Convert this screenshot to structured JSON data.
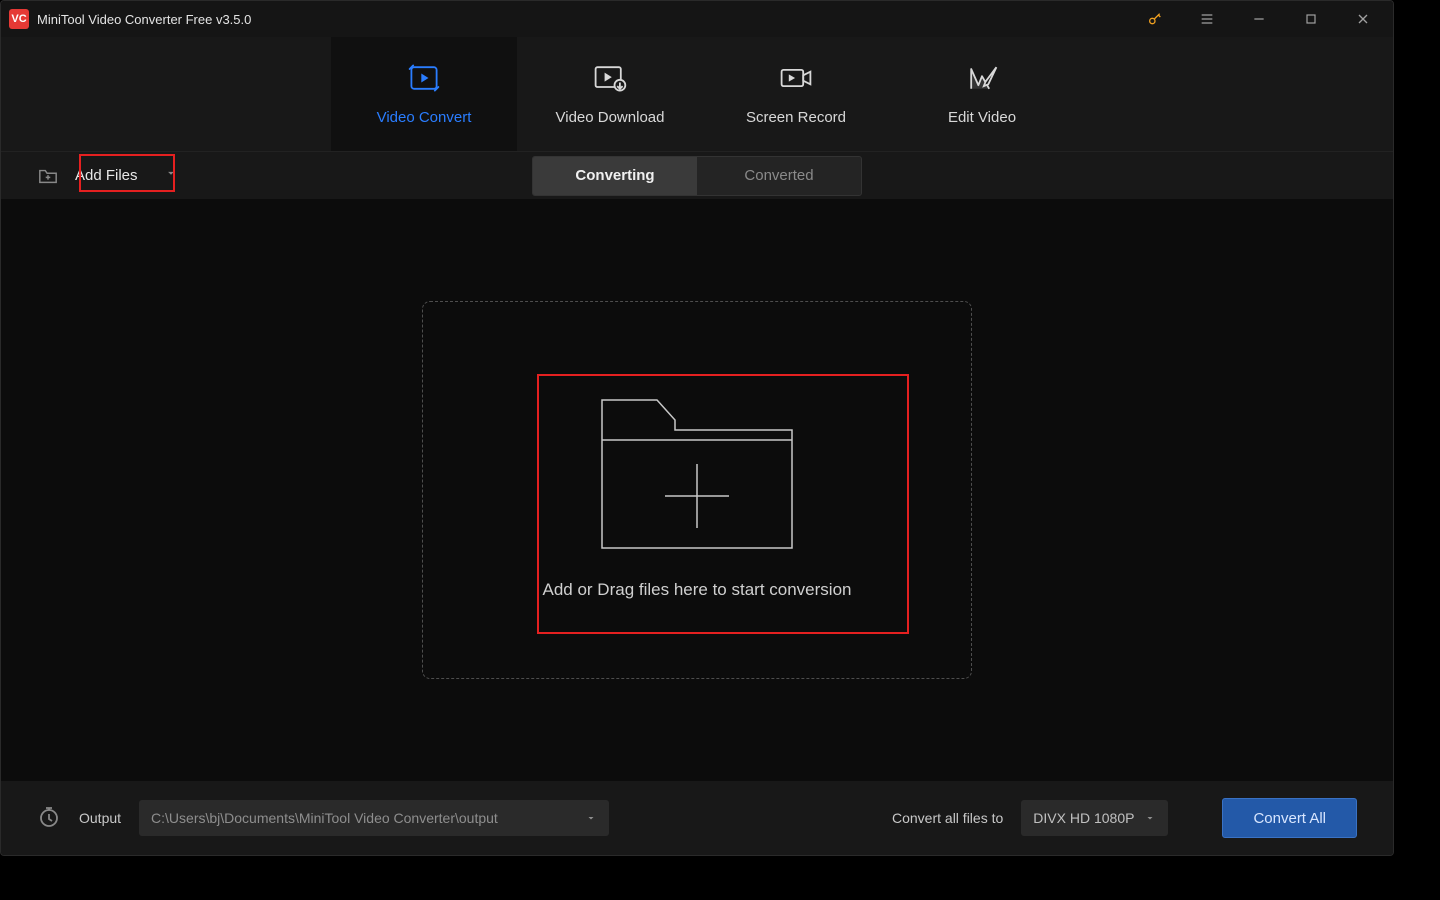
{
  "titlebar": {
    "app_initials": "VC",
    "title": "MiniTool Video Converter Free v3.5.0"
  },
  "features": {
    "tabs": [
      {
        "label": "Video Convert"
      },
      {
        "label": "Video Download"
      },
      {
        "label": "Screen Record"
      },
      {
        "label": "Edit Video"
      }
    ]
  },
  "addbar": {
    "add_files_label": "Add Files",
    "pills": [
      {
        "label": "Converting"
      },
      {
        "label": "Converted"
      }
    ]
  },
  "dropzone": {
    "text": "Add or Drag files here to start conversion"
  },
  "bottom": {
    "output_label": "Output",
    "output_path": "C:\\Users\\bj\\Documents\\MiniTool Video Converter\\output",
    "convert_all_label": "Convert all files to",
    "format_selected": "DIVX HD 1080P",
    "convert_all_button": "Convert All"
  }
}
